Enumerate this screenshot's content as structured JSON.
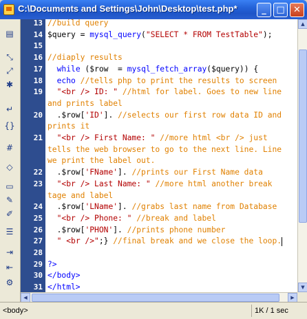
{
  "window": {
    "title": "C:\\Documents and Settings\\John\\Desktop\\test.php*",
    "controls": {
      "minimize": "_",
      "maximize": "□",
      "close": "✕"
    }
  },
  "toolbar": {
    "icons": [
      "file-icon",
      "collapse-icon",
      "expand-icon",
      "select-icon",
      "wrap-icon",
      "indent-icon",
      "tag-icon",
      "snippet-icon",
      "comment-icon",
      "comment-remove-icon",
      "format-icon",
      "checklist-icon",
      "indent-increase-icon",
      "indent-decrease-icon",
      "settings-icon"
    ]
  },
  "code": {
    "colors": {
      "keyword": "#0000ff",
      "comment": "#e08000",
      "string": "#b30000",
      "variable": "#000000",
      "default": "#000000",
      "gutter": "#2e4d8f"
    },
    "lines": [
      {
        "n": "13",
        "text": "//build query"
      },
      {
        "n": "14",
        "text": "$query = mysql_query(\"SELECT * FROM TestTable\");"
      },
      {
        "n": "15",
        "text": ""
      },
      {
        "n": "16",
        "text": "//diaply results"
      },
      {
        "n": "17",
        "text": "  while ($row  = mysql_fetch_array($query)) {"
      },
      {
        "n": "18",
        "text": "  echo //tells php to print the results to screen"
      },
      {
        "n": "19",
        "text": "  \"<br /> ID: \" //html for label. Goes to new line"
      },
      {
        "n": "",
        "text": "and prints label"
      },
      {
        "n": "20",
        "text": "  .$row['ID']. //selects our first row data ID and"
      },
      {
        "n": "",
        "text": "prints it"
      },
      {
        "n": "21",
        "text": "  \"<br /> First Name: \" //more html <br /> just"
      },
      {
        "n": "",
        "text": "tells the web browser to go to the next line. Line"
      },
      {
        "n": "",
        "text": "we print the label out."
      },
      {
        "n": "22",
        "text": "  .$row['FName']. //prints our First Name data"
      },
      {
        "n": "23",
        "text": "  \"<br /> Last Name: \" //more html another break"
      },
      {
        "n": "",
        "text": "tage and label"
      },
      {
        "n": "24",
        "text": "  .$row['LName']. //grabs last name from Database"
      },
      {
        "n": "25",
        "text": "  \"<br /> Phone: \" //break and label"
      },
      {
        "n": "26",
        "text": "  .$row['PHON']. //prints phone number"
      },
      {
        "n": "27",
        "text": "  \" <br />\";} //final break and we close the loop."
      },
      {
        "n": "28",
        "text": ""
      },
      {
        "n": "29",
        "text": "?>"
      },
      {
        "n": "30",
        "text": "</body>"
      },
      {
        "n": "31",
        "text": "</html>"
      }
    ]
  },
  "status": {
    "tag": "<body>",
    "size": "1K / 1 sec"
  }
}
